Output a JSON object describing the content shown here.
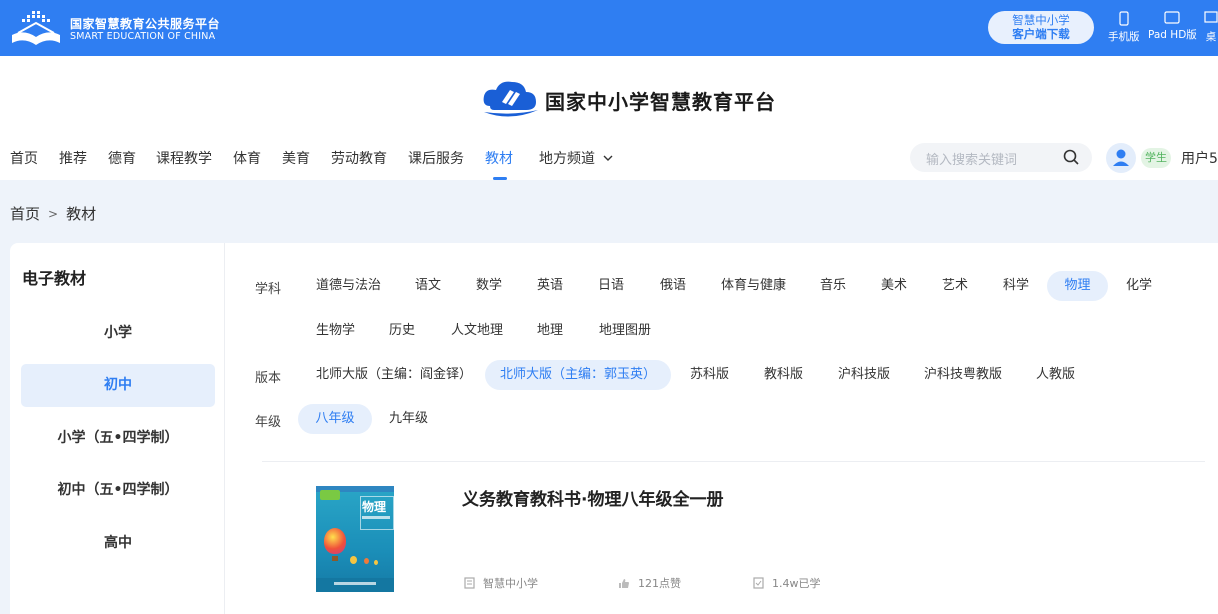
{
  "topbar": {
    "logo_cn": "国家智慧教育公共服务平台",
    "logo_en": "SMART EDUCATION OF CHINA",
    "app_download": {
      "line1": "智慧中小学",
      "line2": "客户端下载"
    },
    "devices": [
      {
        "label": "手机版",
        "icon": "phone-icon"
      },
      {
        "label": "Pad HD版",
        "icon": "tablet-icon"
      },
      {
        "label": "桌",
        "icon": "desktop-icon"
      }
    ]
  },
  "header": {
    "brand_title": "国家中小学智慧教育平台",
    "nav": [
      {
        "label": "首页"
      },
      {
        "label": "推荐"
      },
      {
        "label": "德育"
      },
      {
        "label": "课程教学"
      },
      {
        "label": "体育"
      },
      {
        "label": "美育"
      },
      {
        "label": "劳动教育"
      },
      {
        "label": "课后服务"
      },
      {
        "label": "教材"
      },
      {
        "label": "地方频道"
      }
    ],
    "active_nav": "教材",
    "search_placeholder": "输入搜索关键词",
    "user_badge": "学生",
    "username": "用户5"
  },
  "breadcrumb": {
    "home": "首页",
    "separator": ">",
    "current": "教材"
  },
  "sidebar": {
    "title": "电子教材",
    "items": [
      {
        "label": "小学"
      },
      {
        "label": "初中"
      },
      {
        "label": "小学（五•四学制）"
      },
      {
        "label": "初中（五•四学制）"
      },
      {
        "label": "高中"
      }
    ],
    "active": "初中"
  },
  "filters": {
    "subject_label": "学科",
    "subjects": [
      "道德与法治",
      "语文",
      "数学",
      "英语",
      "日语",
      "俄语",
      "体育与健康",
      "音乐",
      "美术",
      "艺术",
      "科学",
      "物理",
      "化学",
      "生物学",
      "历史",
      "人文地理",
      "地理",
      "地理图册"
    ],
    "active_subject": "物理",
    "edition_label": "版本",
    "editions": [
      "北师大版（主编：阎金铎）",
      "北师大版（主编：郭玉英）",
      "苏科版",
      "教科版",
      "沪科技版",
      "沪科技粤教版",
      "人教版"
    ],
    "active_edition": "北师大版（主编：郭玉英）",
    "grade_label": "年级",
    "grades": [
      "八年级",
      "九年级"
    ],
    "active_grade": "八年级"
  },
  "books": [
    {
      "title": "义务教育教科书·物理八年级全一册",
      "cover_text": "物理",
      "publisher": "智慧中小学",
      "likes": "121点赞",
      "learned": "1.4w已学"
    }
  ],
  "colors": {
    "brand_blue": "#2f7ef2",
    "active_bg": "#e6effc",
    "page_bg": "#eef3fa"
  }
}
